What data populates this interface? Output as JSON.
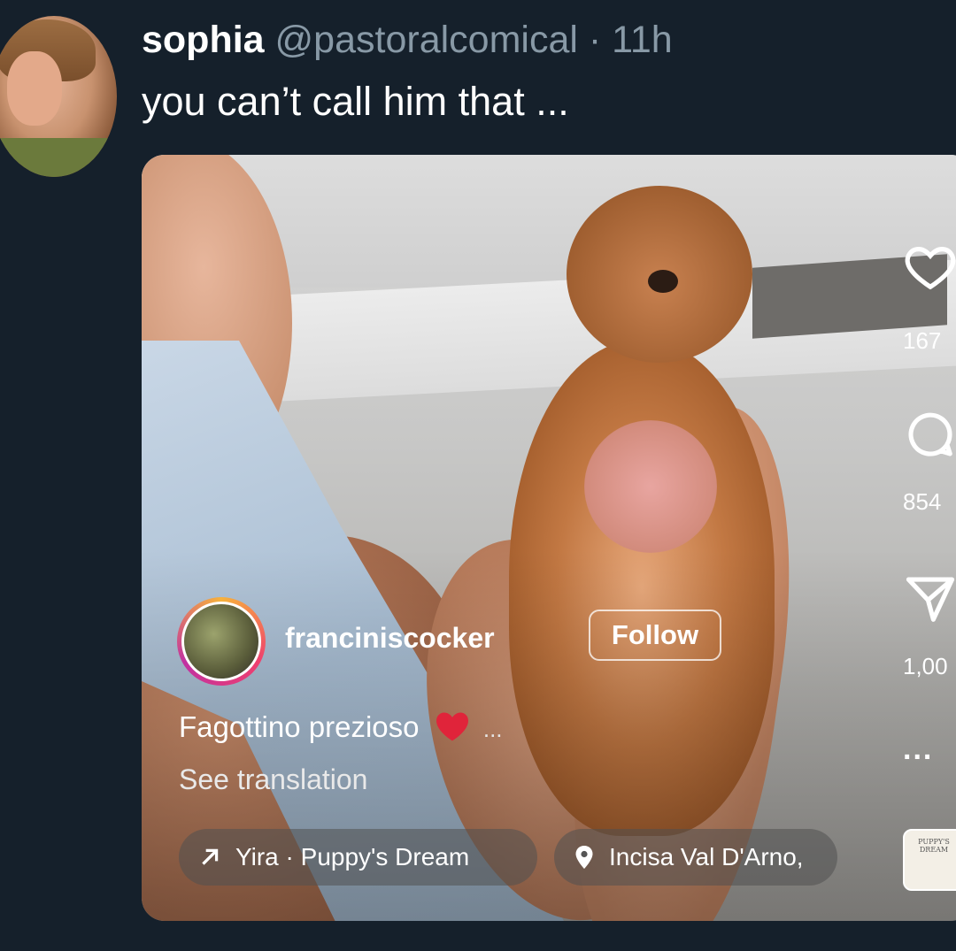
{
  "tweet": {
    "author_name": "sophia",
    "author_handle": "@pastoralcomical",
    "separator": "·",
    "timestamp": "11h",
    "text": "you can’t call him that ..."
  },
  "reel": {
    "creator_username": "franciniscocker",
    "follow_label": "Follow",
    "caption_text": "Fagottino prezioso",
    "caption_emoji_icon": "red-heart-icon",
    "caption_more": "...",
    "see_translation": "See translation",
    "audio_label": "Yira · Puppy's Dream",
    "location_label": "Incisa Val D'Arno,",
    "likes_count": "167",
    "comments_count": "854",
    "shares_count": "1,00",
    "more_label": "...",
    "album_thumb_text": "PUPPY'S DREAM"
  },
  "colors": {
    "background": "#15202b",
    "handle_gray": "#8899a6",
    "heart_red": "#e0243a"
  }
}
